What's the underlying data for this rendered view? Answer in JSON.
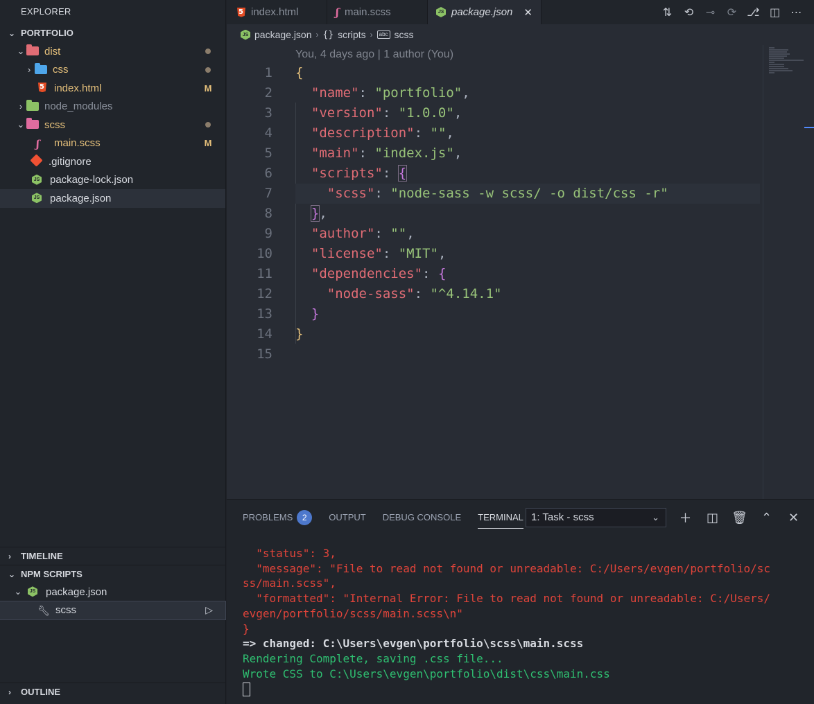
{
  "sidebar": {
    "title": "EXPLORER",
    "project": "PORTFOLIO",
    "tree": [
      {
        "name": "dist",
        "status": "",
        "dot": true
      },
      {
        "name": "css",
        "status": "",
        "dot": true
      },
      {
        "name": "index.html",
        "status": "M",
        "dot": false
      },
      {
        "name": "node_modules",
        "status": "",
        "dot": false
      },
      {
        "name": "scss",
        "status": "",
        "dot": true
      },
      {
        "name": "main.scss",
        "status": "M",
        "dot": false
      },
      {
        "name": ".gitignore",
        "status": "",
        "dot": false
      },
      {
        "name": "package-lock.json",
        "status": "",
        "dot": false
      },
      {
        "name": "package.json",
        "status": "",
        "dot": false
      }
    ],
    "timeline": "TIMELINE",
    "npm_scripts": "NPM SCRIPTS",
    "npm_items": [
      {
        "name": "package.json"
      },
      {
        "name": "scss"
      }
    ],
    "outline": "OUTLINE"
  },
  "tabs": [
    {
      "label": "index.html",
      "icon": "html5-icon"
    },
    {
      "label": "main.scss",
      "icon": "sass-icon"
    },
    {
      "label": "package.json",
      "icon": "nodejs-icon",
      "active": true
    }
  ],
  "breadcrumb": {
    "file": "package.json",
    "scripts": "scripts",
    "leaf": "scss"
  },
  "editor": {
    "blame": "You, 4 days ago | 1 author (You)",
    "line_numbers": [
      "1",
      "2",
      "3",
      "4",
      "5",
      "6",
      "7",
      "8",
      "9",
      "10",
      "11",
      "12",
      "13",
      "14",
      "15"
    ],
    "lines": [
      [
        {
          "t": "{",
          "c": "b1"
        }
      ],
      [
        {
          "t": "  "
        },
        {
          "t": "\"name\"",
          "c": "k"
        },
        {
          "t": ": "
        },
        {
          "t": "\"portfolio\"",
          "c": "s"
        },
        {
          "t": ","
        }
      ],
      [
        {
          "t": "  "
        },
        {
          "t": "\"version\"",
          "c": "k"
        },
        {
          "t": ": "
        },
        {
          "t": "\"1.0.0\"",
          "c": "s"
        },
        {
          "t": ","
        }
      ],
      [
        {
          "t": "  "
        },
        {
          "t": "\"description\"",
          "c": "k"
        },
        {
          "t": ": "
        },
        {
          "t": "\"\"",
          "c": "s"
        },
        {
          "t": ","
        }
      ],
      [
        {
          "t": "  "
        },
        {
          "t": "\"main\"",
          "c": "k"
        },
        {
          "t": ": "
        },
        {
          "t": "\"index.js\"",
          "c": "s"
        },
        {
          "t": ","
        }
      ],
      [
        {
          "t": "  "
        },
        {
          "t": "\"scripts\"",
          "c": "k"
        },
        {
          "t": ": "
        },
        {
          "t": "{",
          "c": "b2 bbox"
        }
      ],
      [
        {
          "t": "    "
        },
        {
          "t": "\"scss\"",
          "c": "k"
        },
        {
          "t": ": "
        },
        {
          "t": "\"node-sass -w scss/ -o dist/css -r\"",
          "c": "s"
        }
      ],
      [
        {
          "t": "  "
        },
        {
          "t": "}",
          "c": "b2 bbox"
        },
        {
          "t": ","
        }
      ],
      [
        {
          "t": "  "
        },
        {
          "t": "\"author\"",
          "c": "k"
        },
        {
          "t": ": "
        },
        {
          "t": "\"\"",
          "c": "s"
        },
        {
          "t": ","
        }
      ],
      [
        {
          "t": "  "
        },
        {
          "t": "\"license\"",
          "c": "k"
        },
        {
          "t": ": "
        },
        {
          "t": "\"MIT\"",
          "c": "s"
        },
        {
          "t": ","
        }
      ],
      [
        {
          "t": "  "
        },
        {
          "t": "\"dependencies\"",
          "c": "k"
        },
        {
          "t": ": "
        },
        {
          "t": "{",
          "c": "b2"
        }
      ],
      [
        {
          "t": "    "
        },
        {
          "t": "\"node-sass\"",
          "c": "k"
        },
        {
          "t": ": "
        },
        {
          "t": "\"^4.14.1\"",
          "c": "s"
        }
      ],
      [
        {
          "t": "  "
        },
        {
          "t": "}",
          "c": "b2"
        }
      ],
      [
        {
          "t": "}",
          "c": "b1"
        }
      ],
      []
    ]
  },
  "panel": {
    "tabs": [
      "PROBLEMS",
      "OUTPUT",
      "DEBUG CONSOLE",
      "TERMINAL"
    ],
    "problems_count": "2",
    "task": "1: Task - scss",
    "terminal": [
      {
        "t": "  \"status\": 3,",
        "c": "t-red"
      },
      {
        "t": "  \"message\": \"File to read not found or unreadable: C:/Users/evgen/portfolio/sc",
        "c": "t-red"
      },
      {
        "t": "ss/main.scss\",",
        "c": "t-red"
      },
      {
        "t": "  \"formatted\": \"Internal Error: File to read not found or unreadable: C:/Users/",
        "c": "t-red"
      },
      {
        "t": "evgen/portfolio/scss/main.scss\\n\"",
        "c": "t-red"
      },
      {
        "t": "}",
        "c": "t-red"
      },
      {
        "t": "=> changed: C:\\Users\\evgen\\portfolio\\scss\\main.scss",
        "c": "t-white"
      },
      {
        "t": "Rendering Complete, saving .css file...",
        "c": "t-green"
      },
      {
        "t": "Wrote CSS to C:\\Users\\evgen\\portfolio\\dist\\css\\main.css",
        "c": "t-green"
      }
    ]
  },
  "colors": {
    "keys": "#e06c75",
    "strings": "#98c379",
    "brace_outer": "#e5c07b",
    "brace_inner": "#c678dd",
    "terminal_error": "#e0443a",
    "terminal_success": "#2fbf71",
    "modified": "#e5c07b"
  }
}
